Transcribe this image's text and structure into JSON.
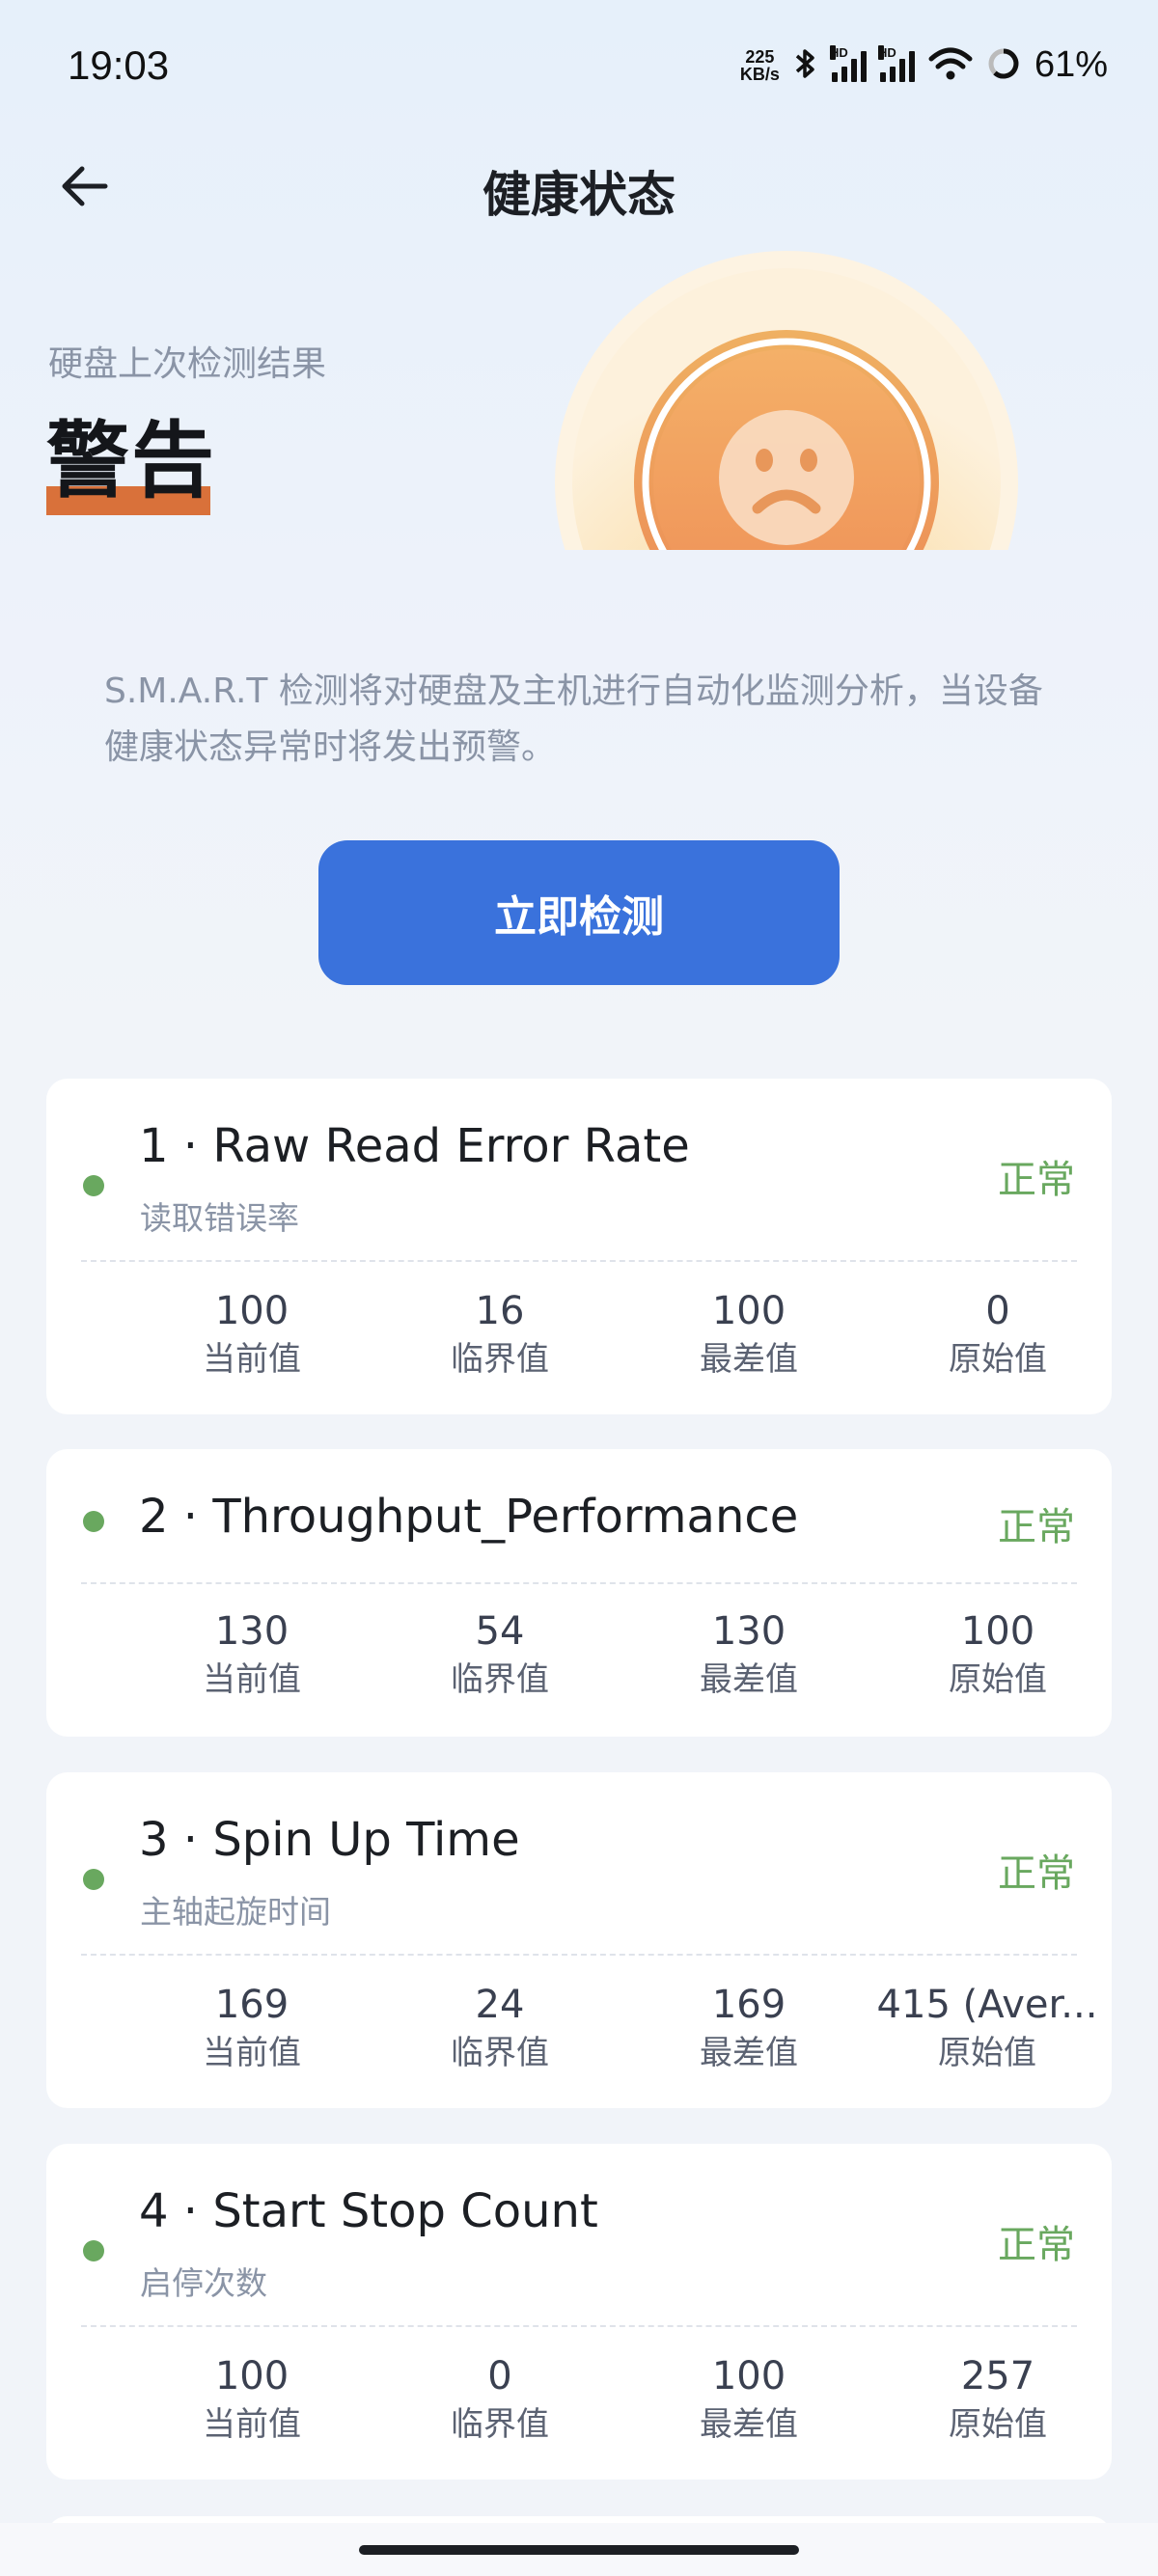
{
  "status_bar": {
    "time": "19:03",
    "net_speed_value": "225",
    "net_speed_unit": "KB/s",
    "hd1": "HD",
    "hd2": "HD",
    "battery_text": "61%"
  },
  "header": {
    "title": "健康状态"
  },
  "hero": {
    "label": "硬盘上次检测结果",
    "status": "警告"
  },
  "description": "S.M.A.R.T 检测将对硬盘及主机进行自动化监测分析，当设备健康状态异常时将发出预警。",
  "detect_button": "立即检测",
  "metric_labels": {
    "current": "当前值",
    "threshold": "临界值",
    "worst": "最差值",
    "raw": "原始值"
  },
  "items": [
    {
      "title": "1 · Raw Read Error Rate",
      "subtitle": "读取错误率",
      "status": "正常",
      "current": "100",
      "threshold": "16",
      "worst": "100",
      "raw": "0"
    },
    {
      "title": "2 · Throughput_Performance",
      "subtitle": "",
      "status": "正常",
      "current": "130",
      "threshold": "54",
      "worst": "130",
      "raw": "100"
    },
    {
      "title": "3 · Spin Up Time",
      "subtitle": "主轴起旋时间",
      "status": "正常",
      "current": "169",
      "threshold": "24",
      "worst": "169",
      "raw": "415 (Aver..."
    },
    {
      "title": "4 · Start Stop Count",
      "subtitle": "启停次数",
      "status": "正常",
      "current": "100",
      "threshold": "0",
      "worst": "100",
      "raw": "257"
    }
  ],
  "colors": {
    "accent": "#3a72dc",
    "warning": "#d9713a",
    "ok": "#69a85f"
  },
  "icons": [
    "back-arrow-icon",
    "bluetooth-icon",
    "signal-icon",
    "wifi-icon",
    "battery-ring-icon",
    "sad-face-icon"
  ]
}
